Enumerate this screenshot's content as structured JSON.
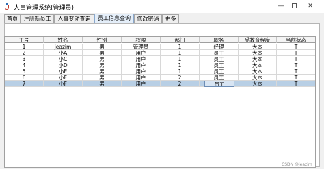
{
  "window": {
    "title": "人事管理系统(管理员)",
    "controls": {
      "minimize": "—",
      "close": "✕"
    }
  },
  "tabs": [
    {
      "label": "首页",
      "active": false
    },
    {
      "label": "注册新员工",
      "active": false
    },
    {
      "label": "人事变动查询",
      "active": false
    },
    {
      "label": "员工信息查询",
      "active": true
    },
    {
      "label": "修改密码",
      "active": false
    },
    {
      "label": "更多",
      "active": false
    }
  ],
  "table": {
    "columns": [
      "工号",
      "姓名",
      "性别",
      "权限",
      "部门",
      "职务",
      "受教育程度",
      "当前状态"
    ],
    "rows": [
      [
        "1",
        "jeazim",
        "男",
        "管理员",
        "1",
        "经理",
        "大本",
        "T"
      ],
      [
        "2",
        "小A",
        "男",
        "用户",
        "1",
        "员工",
        "大本",
        "T"
      ],
      [
        "3",
        "小C",
        "男",
        "用户",
        "1",
        "员工",
        "大本",
        "T"
      ],
      [
        "4",
        "小D",
        "男",
        "用户",
        "1",
        "员工",
        "大本",
        "T"
      ],
      [
        "5",
        "小E",
        "男",
        "用户",
        "1",
        "员工",
        "大本",
        "T"
      ],
      [
        "6",
        "小F",
        "男",
        "用户",
        "2",
        "员工",
        "大本",
        "T"
      ],
      [
        "7",
        "小F",
        "男",
        "用户",
        "2",
        "员工",
        "大本",
        "T"
      ]
    ],
    "selected_row": 7
  },
  "watermark": "CSDN @jeazim",
  "colors": {
    "active_tab": "#e4eef9",
    "selected_row": "#b8cfe5",
    "header_bg": "#f4f4f4"
  }
}
